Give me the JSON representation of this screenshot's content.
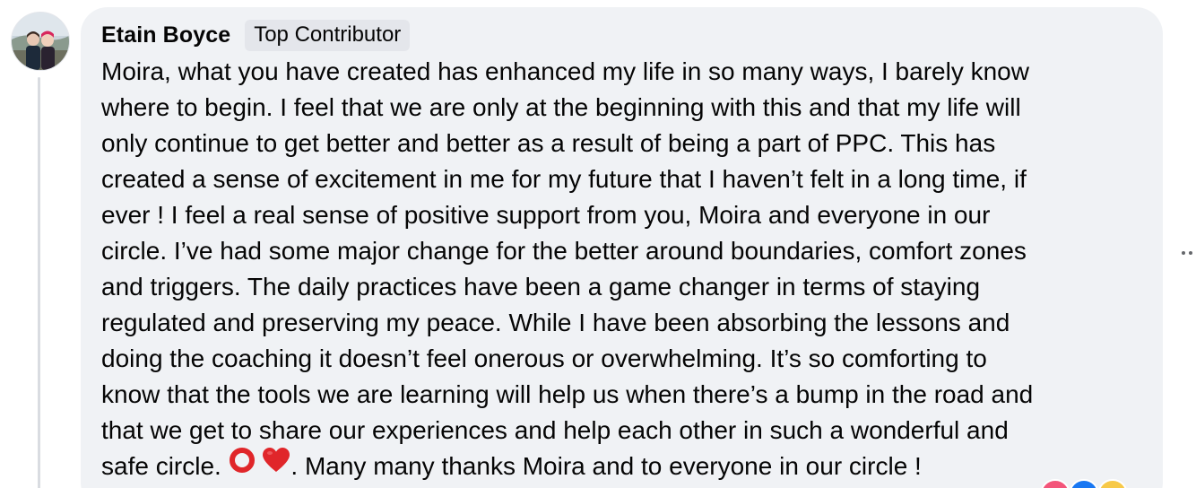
{
  "comment": {
    "author": "Etain Boyce",
    "badge": "Top Contributor",
    "lines": [
      "Moira, what you have created has enhanced my life in so many ways, I barely know",
      "where to begin. I feel that we are only at the beginning with this and that my life will",
      "only continue to get better and better as a result of being a part of PPC. This has",
      "created a sense of excitement in me for my future that I haven’t felt in a long time, if",
      "ever ! I feel a real sense of positive support from you, Moira and everyone in our",
      "circle. I’ve had some major change for the better around boundaries, comfort zones",
      "and triggers. The daily practices have been a game changer in terms of staying",
      "regulated and preserving my peace. While I have been absorbing the lessons and",
      "doing the coaching it doesn’t feel onerous or overwhelming. It’s so comforting to",
      "know that the tools we are learning will help us when there’s a bump in the road and",
      "that we get to share our experiences and help each other in such a wonderful and"
    ],
    "last_line_start": "safe circle. ",
    "last_line_end": ". Many many thanks Moira and to everyone in our circle !",
    "emojis": [
      "red-circle-emoji",
      "red-heart-emoji"
    ]
  },
  "icons": {
    "avatar": "profile-photo",
    "more": "more-horizontal-icon"
  },
  "colors": {
    "bubble": "#f0f2f5",
    "badge_bg": "#e4e6eb",
    "text": "#050505",
    "thread_line": "#d9dce1",
    "emoji_red": "#e0262a"
  }
}
